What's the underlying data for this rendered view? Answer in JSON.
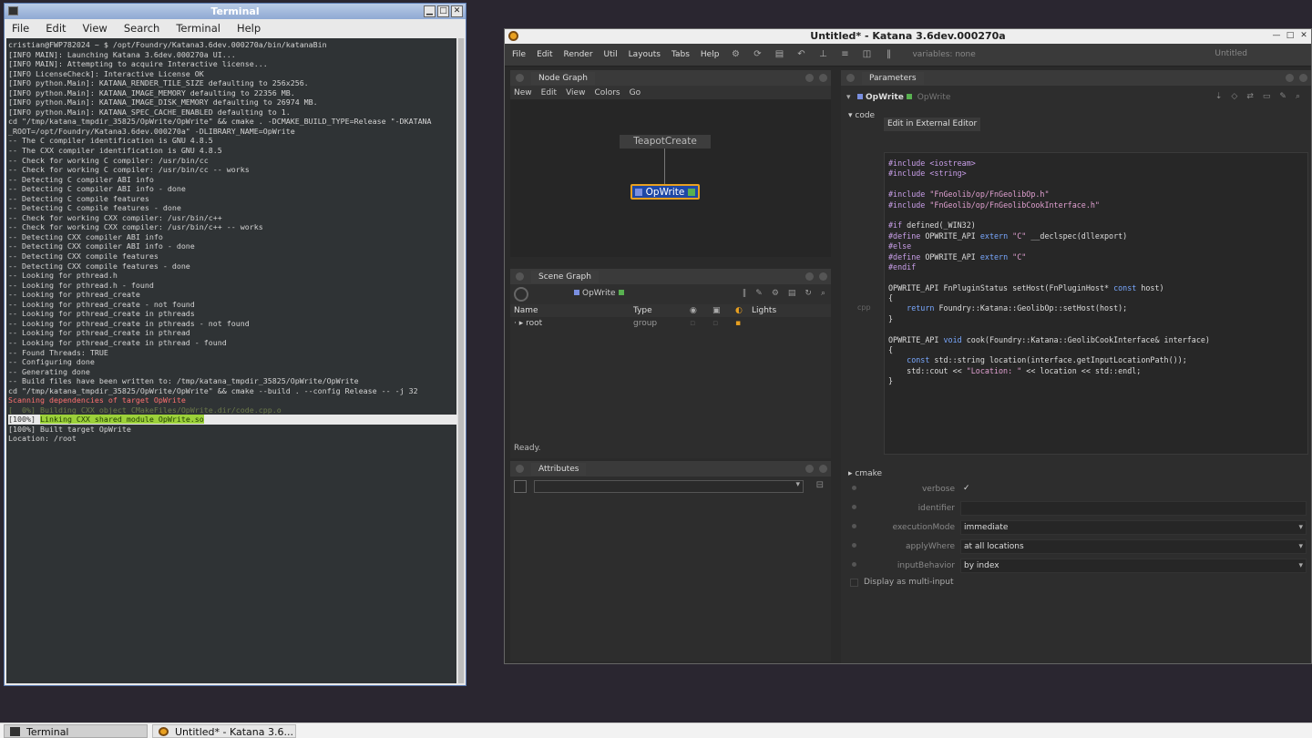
{
  "terminal": {
    "title": "Terminal",
    "menu": [
      "File",
      "Edit",
      "View",
      "Search",
      "Terminal",
      "Help"
    ],
    "lines": [
      {
        "t": "cristian@FWP782024 ~ $ /opt/Foundry/Katana3.6dev.000270a/bin/katanaBin",
        "k": ""
      },
      {
        "t": "[INFO MAIN]: Launching Katana 3.6dev.000270a UI...",
        "k": ""
      },
      {
        "t": "[INFO MAIN]: Attempting to acquire Interactive license...",
        "k": ""
      },
      {
        "t": "[INFO LicenseCheck]: Interactive License OK",
        "k": ""
      },
      {
        "t": "[INFO python.Main]: KATANA_RENDER_TILE_SIZE defaulting to 256x256.",
        "k": ""
      },
      {
        "t": "[INFO python.Main]: KATANA_IMAGE_MEMORY defaulting to 22356 MB.",
        "k": ""
      },
      {
        "t": "[INFO python.Main]: KATANA_IMAGE_DISK_MEMORY defaulting to 26974 MB.",
        "k": ""
      },
      {
        "t": "[INFO python.Main]: KATANA_SPEC_CACHE_ENABLED defaulting to 1.",
        "k": ""
      },
      {
        "t": "cd \"/tmp/katana_tmpdir_35825/OpWrite/OpWrite\" && cmake . -DCMAKE_BUILD_TYPE=Release \"-DKATANA",
        "k": ""
      },
      {
        "t": "_ROOT=/opt/Foundry/Katana3.6dev.000270a\" -DLIBRARY_NAME=OpWrite",
        "k": ""
      },
      {
        "t": "-- The C compiler identification is GNU 4.8.5",
        "k": ""
      },
      {
        "t": "-- The CXX compiler identification is GNU 4.8.5",
        "k": ""
      },
      {
        "t": "-- Check for working C compiler: /usr/bin/cc",
        "k": ""
      },
      {
        "t": "-- Check for working C compiler: /usr/bin/cc -- works",
        "k": ""
      },
      {
        "t": "-- Detecting C compiler ABI info",
        "k": ""
      },
      {
        "t": "-- Detecting C compiler ABI info - done",
        "k": ""
      },
      {
        "t": "-- Detecting C compile features",
        "k": ""
      },
      {
        "t": "-- Detecting C compile features - done",
        "k": ""
      },
      {
        "t": "-- Check for working CXX compiler: /usr/bin/c++",
        "k": ""
      },
      {
        "t": "-- Check for working CXX compiler: /usr/bin/c++ -- works",
        "k": ""
      },
      {
        "t": "-- Detecting CXX compiler ABI info",
        "k": ""
      },
      {
        "t": "-- Detecting CXX compiler ABI info - done",
        "k": ""
      },
      {
        "t": "-- Detecting CXX compile features",
        "k": ""
      },
      {
        "t": "-- Detecting CXX compile features - done",
        "k": ""
      },
      {
        "t": "-- Looking for pthread.h",
        "k": ""
      },
      {
        "t": "-- Looking for pthread.h - found",
        "k": ""
      },
      {
        "t": "-- Looking for pthread_create",
        "k": ""
      },
      {
        "t": "-- Looking for pthread_create - not found",
        "k": ""
      },
      {
        "t": "-- Looking for pthread_create in pthreads",
        "k": ""
      },
      {
        "t": "-- Looking for pthread_create in pthreads - not found",
        "k": ""
      },
      {
        "t": "-- Looking for pthread_create in pthread",
        "k": ""
      },
      {
        "t": "-- Looking for pthread_create in pthread - found",
        "k": ""
      },
      {
        "t": "-- Found Threads: TRUE",
        "k": ""
      },
      {
        "t": "-- Configuring done",
        "k": ""
      },
      {
        "t": "-- Generating done",
        "k": ""
      },
      {
        "t": "-- Build files have been written to: /tmp/katana_tmpdir_35825/OpWrite/OpWrite",
        "k": ""
      },
      {
        "t": "cd \"/tmp/katana_tmpdir_35825/OpWrite/OpWrite\" && cmake --build . --config Release -- -j 32",
        "k": ""
      },
      {
        "t": "Scanning dependencies of target OpWrite",
        "k": "red"
      },
      {
        "t": "[  0%] Building CXX object CMakeFiles/OpWrite.dir/code.cpp.o",
        "k": "dim"
      },
      {
        "t": "[100%] ",
        "h": "Linking CXX shared module OpWrite.so",
        "k": "hl"
      },
      {
        "t": "[100%] Built target OpWrite",
        "k": ""
      },
      {
        "t": "Location: /root",
        "k": ""
      }
    ]
  },
  "katana": {
    "title": "Untitled* - Katana 3.6dev.000270a",
    "menu": [
      "File",
      "Edit",
      "Render",
      "Util",
      "Layouts",
      "Tabs",
      "Help"
    ],
    "variables": "variables: none",
    "layout": "Untitled",
    "node_graph": {
      "tab": "Node Graph",
      "menu": [
        "New",
        "Edit",
        "View",
        "Colors",
        "Go"
      ],
      "nodes": {
        "teapot": "TeapotCreate",
        "opwrite": "OpWrite"
      }
    },
    "scene_graph": {
      "tab": "Scene Graph",
      "view_node": "OpWrite",
      "cols": [
        "Name",
        "Type",
        "Lights"
      ],
      "rows": [
        {
          "name": "root",
          "type": "group"
        }
      ],
      "status": "Ready."
    },
    "attributes": {
      "tab": "Attributes"
    },
    "parameters": {
      "tab": "Parameters",
      "node_name": "OpWrite",
      "node_name_input": "OpWrite",
      "section_code": "code",
      "external_editor": "Edit in External Editor",
      "cpp_label": "cpp",
      "code_lines": [
        [
          {
            "c": "c-inc",
            "t": "#include <iostream>"
          }
        ],
        [
          {
            "c": "c-inc",
            "t": "#include <string>"
          }
        ],
        [],
        [
          {
            "c": "c-inc",
            "t": "#include "
          },
          {
            "c": "c-str",
            "t": "\"FnGeolib/op/FnGeolibOp.h\""
          }
        ],
        [
          {
            "c": "c-inc",
            "t": "#include "
          },
          {
            "c": "c-str",
            "t": "\"FnGeolib/op/FnGeolibCookInterface.h\""
          }
        ],
        [],
        [
          {
            "c": "c-inc",
            "t": "#if "
          },
          {
            "c": "c-fn",
            "t": "defined(_WIN32)"
          }
        ],
        [
          {
            "c": "c-inc",
            "t": "#define "
          },
          {
            "c": "c-fn",
            "t": "OPWRITE_API "
          },
          {
            "c": "c-kw",
            "t": "extern "
          },
          {
            "c": "c-str",
            "t": "\"C\""
          },
          {
            "c": "c-fn",
            "t": " __declspec(dllexport)"
          }
        ],
        [
          {
            "c": "c-inc",
            "t": "#else"
          }
        ],
        [
          {
            "c": "c-inc",
            "t": "#define "
          },
          {
            "c": "c-fn",
            "t": "OPWRITE_API "
          },
          {
            "c": "c-kw",
            "t": "extern "
          },
          {
            "c": "c-str",
            "t": "\"C\""
          }
        ],
        [
          {
            "c": "c-inc",
            "t": "#endif"
          }
        ],
        [],
        [
          {
            "c": "c-fn",
            "t": "OPWRITE_API FnPluginStatus setHost(FnPluginHost* "
          },
          {
            "c": "c-kw",
            "t": "const"
          },
          {
            "c": "c-fn",
            "t": " host)"
          }
        ],
        [
          {
            "c": "c-fn",
            "t": "{"
          }
        ],
        [
          {
            "c": "c-fn",
            "t": "    "
          },
          {
            "c": "c-kw",
            "t": "return"
          },
          {
            "c": "c-fn",
            "t": " Foundry::Katana::GeolibOp::setHost(host);"
          }
        ],
        [
          {
            "c": "c-fn",
            "t": "}"
          }
        ],
        [],
        [
          {
            "c": "c-fn",
            "t": "OPWRITE_API "
          },
          {
            "c": "c-kw",
            "t": "void"
          },
          {
            "c": "c-fn",
            "t": " cook(Foundry::Katana::GeolibCookInterface& interface)"
          }
        ],
        [
          {
            "c": "c-fn",
            "t": "{"
          }
        ],
        [
          {
            "c": "c-fn",
            "t": "    "
          },
          {
            "c": "c-kw",
            "t": "const"
          },
          {
            "c": "c-fn",
            "t": " std::string location(interface.getInputLocationPath());"
          }
        ],
        [
          {
            "c": "c-fn",
            "t": "    std::cout << "
          },
          {
            "c": "c-str",
            "t": "\"Location: \""
          },
          {
            "c": "c-fn",
            "t": " << location << std::endl;"
          }
        ],
        [
          {
            "c": "c-fn",
            "t": "}"
          }
        ]
      ],
      "section_cmake": "cmake",
      "params": [
        {
          "label": "verbose",
          "value": "✓",
          "kind": "check"
        },
        {
          "label": "identifier",
          "value": "",
          "kind": "text"
        },
        {
          "label": "executionMode",
          "value": "immediate",
          "kind": "dd"
        },
        {
          "label": "applyWhere",
          "value": "at all locations",
          "kind": "dd"
        },
        {
          "label": "inputBehavior",
          "value": "by index",
          "kind": "dd"
        }
      ],
      "multi_input": "Display as multi-input"
    }
  },
  "taskbar": {
    "items": [
      "Terminal",
      "Untitled* - Katana 3.6..."
    ]
  }
}
